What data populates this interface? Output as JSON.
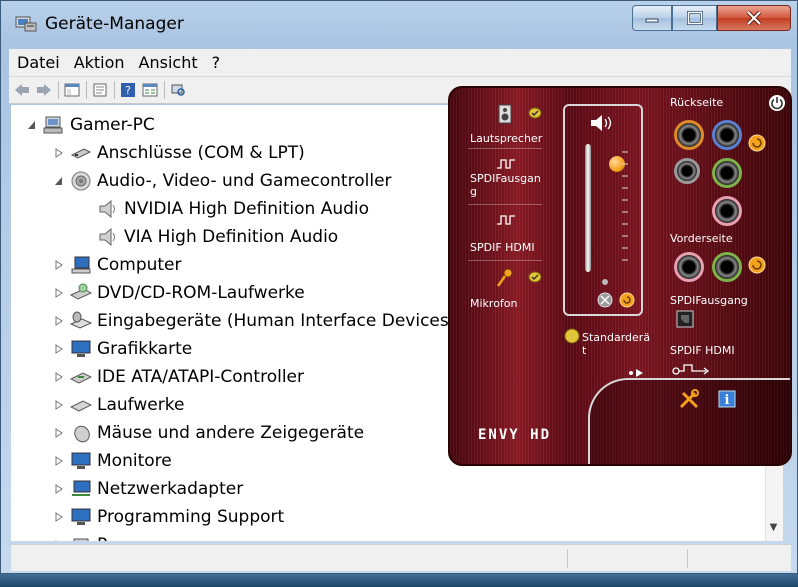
{
  "window": {
    "title": "Geräte-Manager"
  },
  "menu": [
    "Datei",
    "Aktion",
    "Ansicht",
    "?"
  ],
  "toolbar_icons": [
    "back-arrow-icon",
    "forward-arrow-icon",
    "show-hide-tree-icon",
    "properties-icon",
    "help-icon",
    "view-icon",
    "scan-hardware-icon"
  ],
  "tree": {
    "root": "Gamer-PC",
    "items": [
      {
        "label": "Anschlüsse (COM & LPT)",
        "icon": "port-icon",
        "expanded": false
      },
      {
        "label": "Audio-, Video- und Gamecontroller",
        "icon": "speaker-icon",
        "expanded": true,
        "children": [
          "NVIDIA High Definition Audio",
          "VIA High Definition Audio"
        ]
      },
      {
        "label": "Computer",
        "icon": "computer-icon",
        "expanded": false
      },
      {
        "label": "DVD/CD-ROM-Laufwerke",
        "icon": "dvd-drive-icon",
        "expanded": false
      },
      {
        "label": "Eingabegeräte (Human Interface Devices)",
        "icon": "hid-icon",
        "expanded": false
      },
      {
        "label": "Grafikkarte",
        "icon": "monitor-icon",
        "expanded": false
      },
      {
        "label": "IDE ATA/ATAPI-Controller",
        "icon": "controller-icon",
        "expanded": false
      },
      {
        "label": "Laufwerke",
        "icon": "disk-drive-icon",
        "expanded": false
      },
      {
        "label": "Mäuse und andere Zeigegeräte",
        "icon": "mouse-icon",
        "expanded": false
      },
      {
        "label": "Monitore",
        "icon": "monitor-icon",
        "expanded": false
      },
      {
        "label": "Netzwerkadapter",
        "icon": "network-icon",
        "expanded": false
      },
      {
        "label": "Programming Support",
        "icon": "monitor-icon",
        "expanded": false
      },
      {
        "label": "P",
        "icon": "processor-icon",
        "expanded": false
      }
    ]
  },
  "envy": {
    "left": {
      "lautsprecher": "Lautsprecher",
      "spdif_ausgang": "SPDIFausgan\ng",
      "spdif_hdmi": "SPDIF HDMI",
      "mikrofon": "Mikrofon"
    },
    "standard_label": "Standarderä\nt",
    "volume_level": 0.82,
    "rueckseite": "Rückseite",
    "vorderseite": "Vorderseite",
    "spdif_ausgang_right": "SPDIFausgang",
    "spdif_hdmi_right": "SPDIF HDMI",
    "logo": "ENVY HD",
    "colors": {
      "jack_orange": "#e08a2a",
      "jack_blue": "#5b7fd1",
      "jack_green": "#7fb24a",
      "jack_pink": "#e8a0b0",
      "jack_gray": "#9a9a9a",
      "knob": "#f4a11c"
    }
  }
}
